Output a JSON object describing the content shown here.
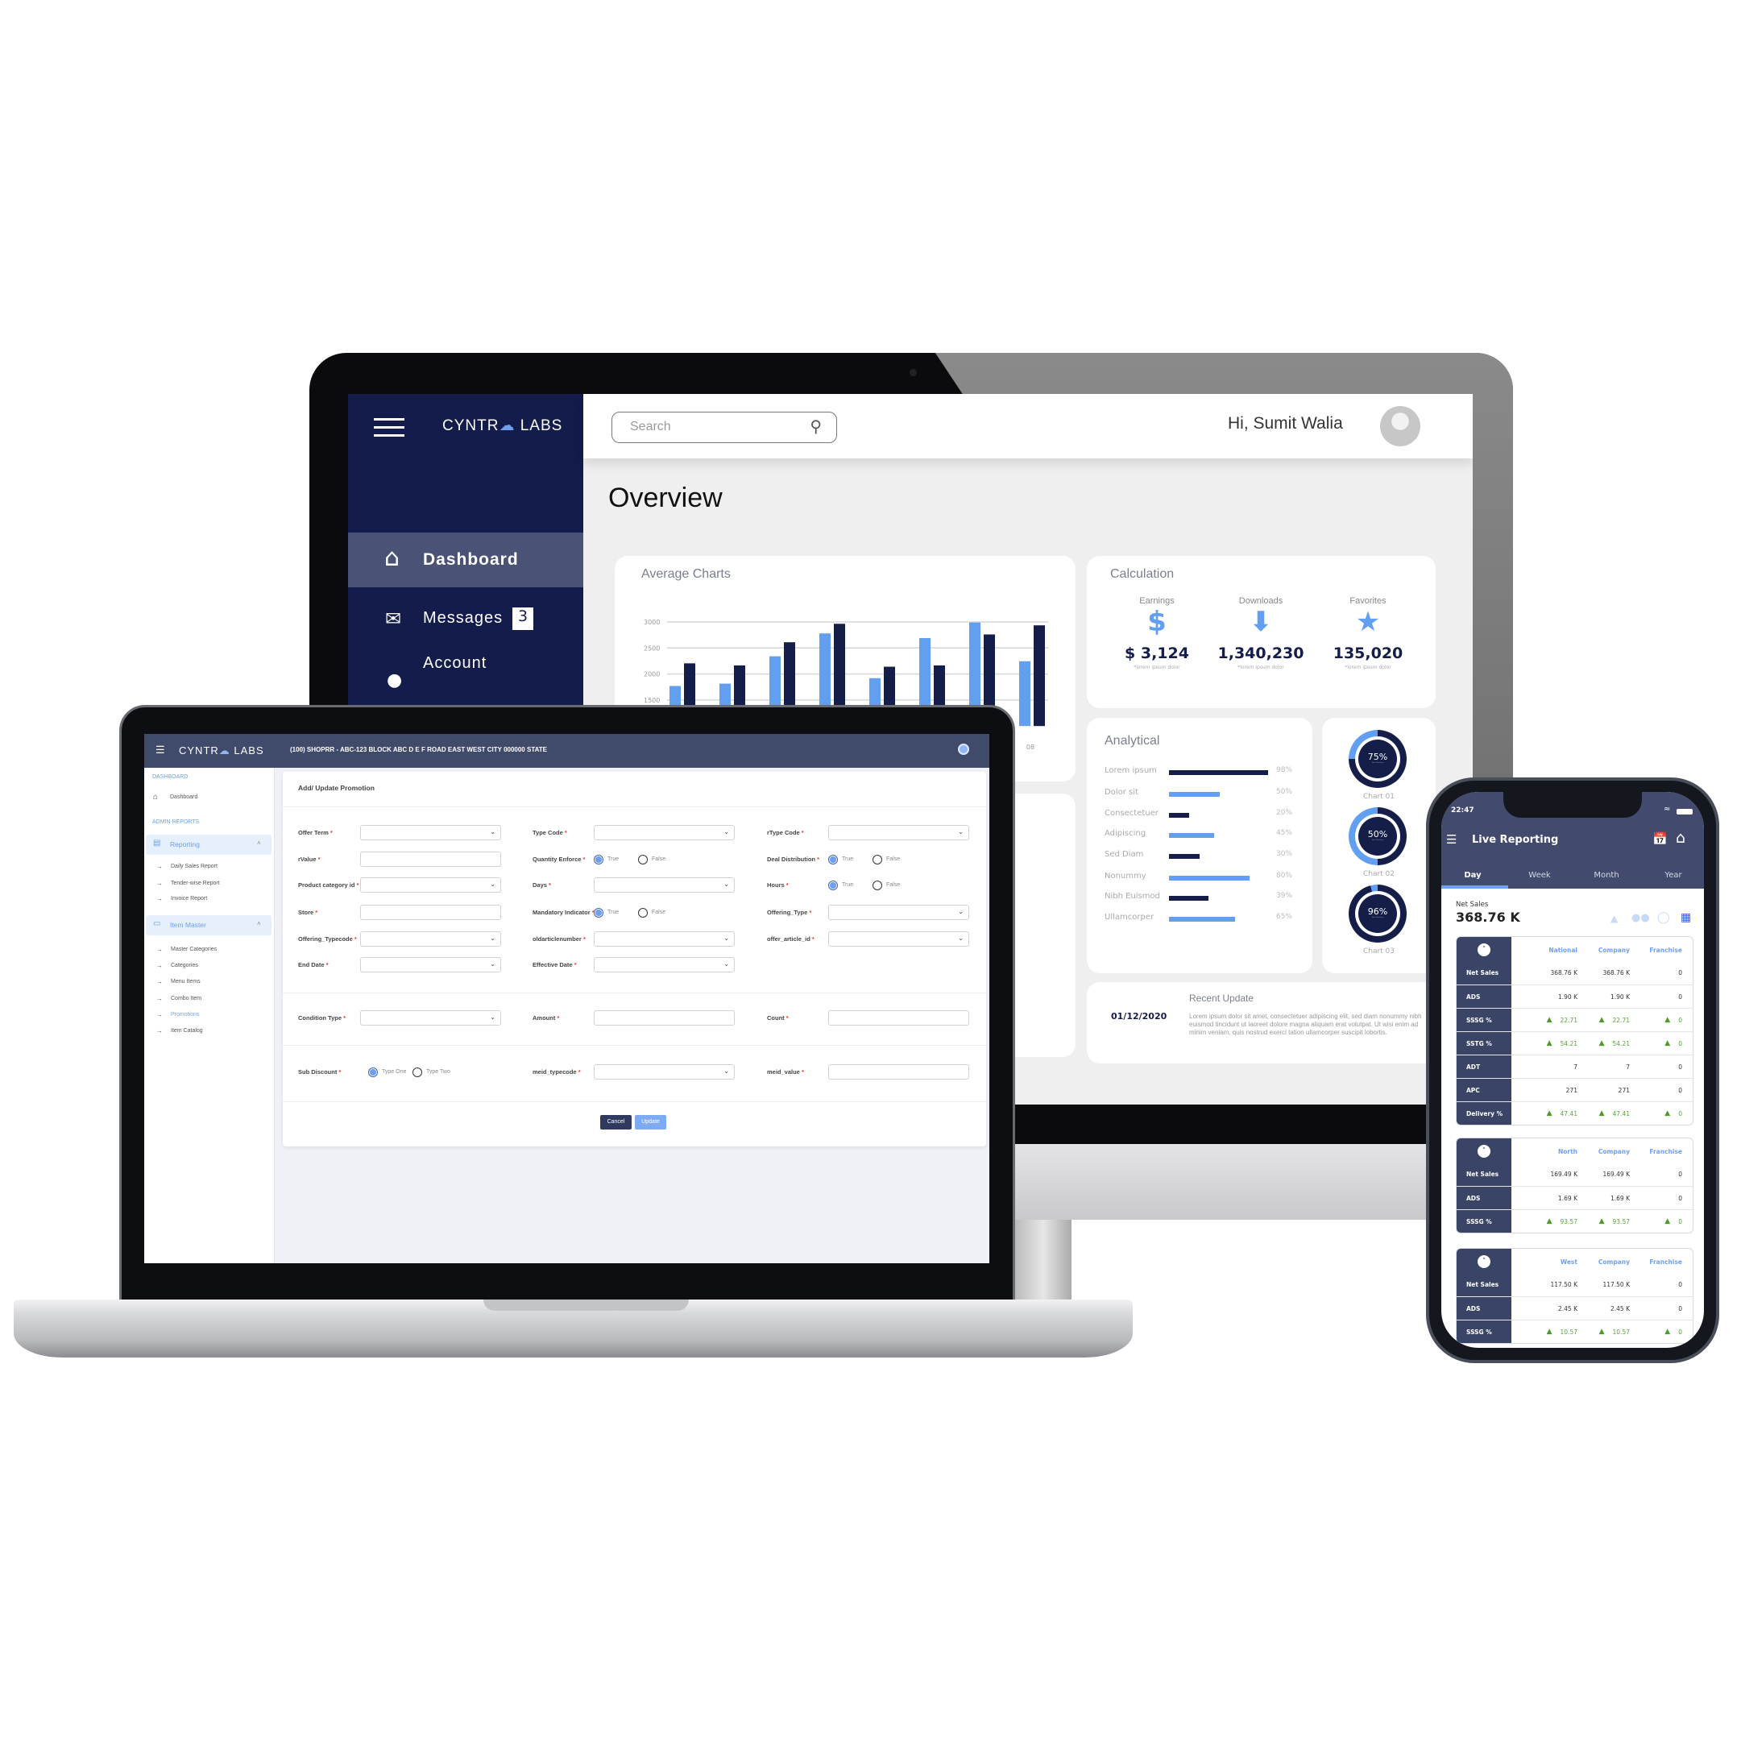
{
  "monitor": {
    "logo": {
      "left": "CYNTR",
      "right": "LABS"
    },
    "search_placeholder": "Search",
    "greeting": "Hi, Sumit Walia",
    "nav": [
      {
        "label": "Dashboard",
        "icon": "home-icon",
        "active": true
      },
      {
        "label": "Messages",
        "icon": "envelope-icon",
        "badge": "3"
      },
      {
        "label": "Account",
        "icon": "user-icon"
      }
    ],
    "page_title": "Overview",
    "colors": {
      "sidebar": "#131c4a",
      "accent": "#629ff0",
      "navy": "#141e48"
    },
    "average_chart_title": "Average Charts",
    "calculation": {
      "title": "Calculation",
      "items": [
        {
          "label": "Earnings",
          "icon": "dollar-icon",
          "value": "$ 3,124",
          "note": "*lorem ipsum dolor"
        },
        {
          "label": "Downloads",
          "icon": "arrow-down-icon",
          "value": "1,340,230",
          "note": "*lorem ipsum dolor"
        },
        {
          "label": "Favorites",
          "icon": "star-icon",
          "value": "135,020",
          "note": "*lorem ipsum dolor"
        }
      ]
    },
    "analytical": {
      "title": "Analytical",
      "rows": [
        {
          "label": "Lorem ipsum",
          "value": 98,
          "text": "98%"
        },
        {
          "label": "Dolor sit",
          "value": 50,
          "text": "50%"
        },
        {
          "label": "Consectetuer",
          "value": 20,
          "text": "20%"
        },
        {
          "label": "Adipiscing",
          "value": 45,
          "text": "45%"
        },
        {
          "label": "Sed Diam",
          "value": 30,
          "text": "30%"
        },
        {
          "label": "Nonummy",
          "value": 80,
          "text": "80%"
        },
        {
          "label": "Nibh Euismod",
          "value": 39,
          "text": "39%"
        },
        {
          "label": "Ullamcorper",
          "value": 65,
          "text": "65%"
        }
      ]
    },
    "donuts": [
      {
        "value": 75,
        "text": "75%",
        "sub": "Your Text Here",
        "label": "Chart 01"
      },
      {
        "value": 50,
        "text": "50%",
        "sub": "Your Text Here",
        "label": "Chart 02"
      },
      {
        "value": 96,
        "text": "96%",
        "sub": "Your Text Here",
        "label": "Chart 03"
      }
    ],
    "recent": {
      "date": "01/12/2020",
      "title": "Recent Update",
      "text": "Lorem ipsum dolor sit amet, consectetuer adipiscing elit, sed diam nonummy nibh euismod tincidunt ut laoreet dolore magna aliquam erat volutpat. Ut wisi enim ad minim veniam, quis nostrud exerci tation ullamcorper suscipit lobortis."
    }
  },
  "chart_data": {
    "type": "bar",
    "title": "Average Charts",
    "categories": [
      "",
      "",
      "",
      "",
      "",
      "",
      "",
      "08"
    ],
    "series": [
      {
        "color": "#629ff0",
        "values": [
          1770,
          1815,
          2340,
          2780,
          1920,
          2690,
          2990,
          2245
        ]
      },
      {
        "color": "#141e48",
        "values": [
          2205,
          2165,
          2610,
          2965,
          2140,
          2165,
          2760,
          2935
        ]
      }
    ],
    "y_ticks": [
      "3000",
      "2500",
      "2000",
      "1500"
    ],
    "ylim": [
      1000,
      3000
    ],
    "grid": true
  },
  "laptop": {
    "logo": {
      "left": "CYNTR",
      "right": "LABS"
    },
    "store": "(100) SHOPRR - ABC-123 BLOCK ABC D E F ROAD EAST WEST CITY 000000 STATE",
    "sidebar": [
      {
        "type": "section",
        "label": "DASHBOARD"
      },
      {
        "type": "item",
        "label": "Dashboard",
        "icon": "home-icon"
      },
      {
        "type": "section",
        "label": "ADMIN REPORTS"
      },
      {
        "type": "group",
        "label": "Reporting",
        "icon": "clipboard-icon",
        "expanded": true
      },
      {
        "type": "sub",
        "label": "Daily Sales Report"
      },
      {
        "type": "sub",
        "label": "Tender-wise Report"
      },
      {
        "type": "sub",
        "label": "Invoice Report"
      },
      {
        "type": "group",
        "label": "Item Master",
        "icon": "window-icon",
        "expanded": true
      },
      {
        "type": "sub",
        "label": "Master Categories"
      },
      {
        "type": "sub",
        "label": "Categories"
      },
      {
        "type": "sub",
        "label": "Menu Items"
      },
      {
        "type": "sub",
        "label": "Combo Item"
      },
      {
        "type": "sub",
        "label": "Promotions",
        "active": true
      },
      {
        "type": "sub",
        "label": "Item Catalog"
      }
    ],
    "form": {
      "title": "Add/ Update Promotion",
      "sections": [
        [
          [
            {
              "label": "Offer Term",
              "type": "select"
            },
            {
              "label": "Type Code",
              "type": "select"
            },
            {
              "label": "rType Code",
              "type": "select"
            }
          ],
          [
            {
              "label": "rValue",
              "type": "input"
            },
            {
              "label": "Quantity Enforce",
              "type": "radio",
              "options": [
                "True",
                "False"
              ],
              "selected": "True"
            },
            {
              "label": "Deal Distribution",
              "type": "radio",
              "options": [
                "True",
                "False"
              ],
              "selected": "True"
            }
          ],
          [
            {
              "label": "Product category id",
              "type": "select"
            },
            {
              "label": "Days",
              "type": "select"
            },
            {
              "label": "Hours",
              "type": "radio",
              "options": [
                "True",
                "False"
              ],
              "selected": "True"
            }
          ],
          [
            {
              "label": "Store",
              "type": "input"
            },
            {
              "label": "Mandatory Indicator",
              "type": "radio",
              "options": [
                "True",
                "False"
              ],
              "selected": "True"
            },
            {
              "label": "Offering_Type",
              "type": "select"
            }
          ],
          [
            {
              "label": "Offering_Typecode",
              "type": "select"
            },
            {
              "label": "oldarticlenumber",
              "type": "select"
            },
            {
              "label": "offer_article_id",
              "type": "select"
            }
          ],
          [
            {
              "label": "End Date",
              "type": "select"
            },
            {
              "label": "Effective Date",
              "type": "select"
            }
          ]
        ],
        [
          [
            {
              "label": "Condition Type",
              "type": "select"
            },
            {
              "label": "Amount",
              "type": "input"
            },
            {
              "label": "Count",
              "type": "input"
            }
          ]
        ],
        [
          [
            {
              "label": "Sub Discount",
              "type": "radio",
              "options": [
                "Type One",
                "Type Two"
              ],
              "selected": "Type One"
            },
            {
              "label": "meid_typecode",
              "type": "select"
            },
            {
              "label": "meid_value",
              "type": "input"
            }
          ]
        ]
      ],
      "cancel": "Cancel",
      "update": "Update"
    }
  },
  "phone": {
    "time": "22:47",
    "title": "Live Reporting",
    "tabs": [
      "Day",
      "Week",
      "Month",
      "Year"
    ],
    "active_tab": "Day",
    "net_sales_label": "Net Sales",
    "net_sales_value": "368.76 K",
    "filter_icons": [
      "chart-icon",
      "people-icon",
      "globe-icon",
      "store-icon"
    ],
    "tables": [
      {
        "columns": [
          "National",
          "Company",
          "Franchise"
        ],
        "rows": [
          {
            "label": "Net Sales",
            "values": [
              "368.76 K",
              "368.76 K",
              "0"
            ]
          },
          {
            "label": "ADS",
            "values": [
              "1.90 K",
              "1.90 K",
              "0"
            ]
          },
          {
            "label": "SSSG %",
            "values": [
              "22.71",
              "22.71",
              "0"
            ],
            "trend": "up"
          },
          {
            "label": "SSTG %",
            "values": [
              "54.21",
              "54.21",
              "0"
            ],
            "trend": "up"
          },
          {
            "label": "ADT",
            "values": [
              "7",
              "7",
              "0"
            ]
          },
          {
            "label": "APC",
            "values": [
              "271",
              "271",
              "0"
            ]
          },
          {
            "label": "Delivery %",
            "values": [
              "47.41",
              "47.41",
              "0"
            ],
            "trend": "up"
          }
        ]
      },
      {
        "columns": [
          "North",
          "Company",
          "Franchise"
        ],
        "rows": [
          {
            "label": "Net Sales",
            "values": [
              "169.49 K",
              "169.49 K",
              "0"
            ]
          },
          {
            "label": "ADS",
            "values": [
              "1.69 K",
              "1.69 K",
              "0"
            ]
          },
          {
            "label": "SSSG %",
            "values": [
              "93.57",
              "93.57",
              "0"
            ],
            "trend": "up"
          }
        ]
      },
      {
        "columns": [
          "West",
          "Company",
          "Franchise"
        ],
        "rows": [
          {
            "label": "Net Sales",
            "values": [
              "117.50 K",
              "117.50 K",
              "0"
            ]
          },
          {
            "label": "ADS",
            "values": [
              "2.45 K",
              "2.45 K",
              "0"
            ]
          },
          {
            "label": "SSSG %",
            "values": [
              "10.57",
              "10.57",
              "0"
            ],
            "trend": "up"
          }
        ]
      }
    ]
  }
}
